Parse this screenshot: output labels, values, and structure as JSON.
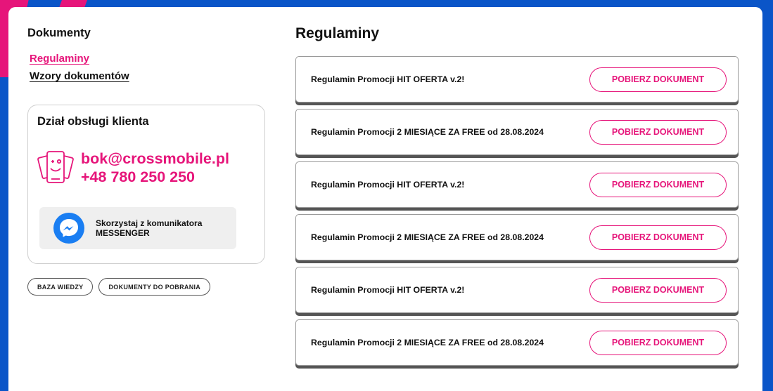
{
  "colors": {
    "accent": "#e6157a",
    "background": "#0a55c8",
    "messenger": "#1a7ef2"
  },
  "sidebar": {
    "title": "Dokumenty",
    "links": [
      {
        "label": "Regulaminy",
        "active": true
      },
      {
        "label": "Wzory dokumentów",
        "active": false
      }
    ]
  },
  "service": {
    "title": "Dział obsługi klienta",
    "email": "bok@crossmobile.pl",
    "phone": "+48 780 250 250",
    "messenger_line1": "Skorzystaj z komunikatora",
    "messenger_line2": "MESSENGER",
    "icons": {
      "contact": "phone-smile-icon",
      "messenger": "messenger-icon"
    }
  },
  "tags": [
    "BAZA WIEDZY",
    "DOKUMENTY DO POBRANIA"
  ],
  "main": {
    "title": "Regulaminy",
    "documents": [
      {
        "name": "Regulamin Promocji HIT OFERTA v.2!",
        "button": "POBIERZ DOKUMENT"
      },
      {
        "name": "Regulamin Promocji 2 MIESIĄCE ZA FREE od 28.08.2024",
        "button": "POBIERZ DOKUMENT"
      },
      {
        "name": "Regulamin Promocji HIT OFERTA v.2!",
        "button": "POBIERZ DOKUMENT"
      },
      {
        "name": "Regulamin Promocji 2 MIESIĄCE ZA FREE od 28.08.2024",
        "button": "POBIERZ DOKUMENT"
      },
      {
        "name": "Regulamin Promocji HIT OFERTA v.2!",
        "button": "POBIERZ DOKUMENT"
      },
      {
        "name": "Regulamin Promocji 2 MIESIĄCE ZA FREE od 28.08.2024",
        "button": "POBIERZ DOKUMENT"
      }
    ]
  }
}
